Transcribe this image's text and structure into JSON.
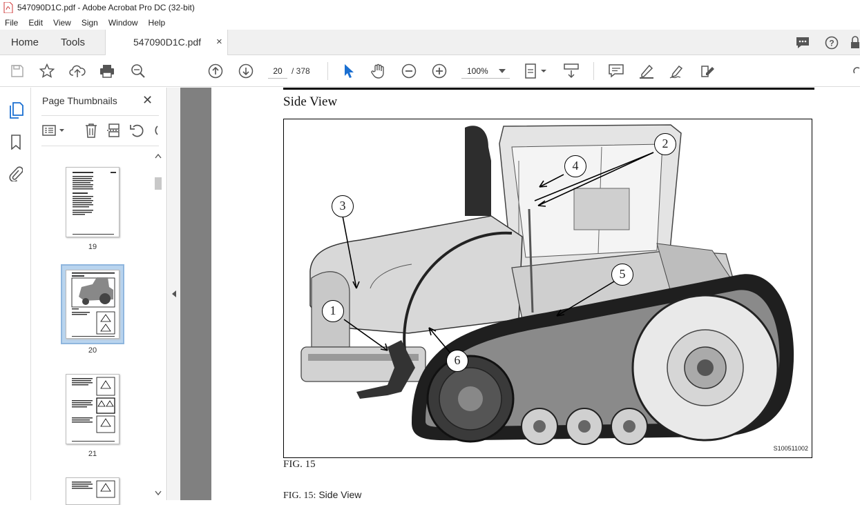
{
  "window": {
    "title": "547090D1C.pdf - Adobe Acrobat Pro DC (32-bit)"
  },
  "menu": [
    "File",
    "Edit",
    "View",
    "Sign",
    "Window",
    "Help"
  ],
  "tabs": {
    "home": "Home",
    "tools": "Tools",
    "document": "547090D1C.pdf",
    "close": "×"
  },
  "toolbar": {
    "page_current": "20",
    "page_separator": "/ 378",
    "zoom": "100%"
  },
  "thumbnails": {
    "title": "Page Thumbnails",
    "close": "✕",
    "pages": [
      {
        "label": "19"
      },
      {
        "label": "20"
      },
      {
        "label": "21"
      }
    ]
  },
  "document": {
    "heading": "Side View",
    "figure_label": "FIG.  15",
    "caption_prefix": "FIG. 15:",
    "caption_text": "Side View",
    "image_id": "S100511002",
    "callouts": [
      "1",
      "2",
      "3",
      "4",
      "5",
      "6"
    ]
  }
}
